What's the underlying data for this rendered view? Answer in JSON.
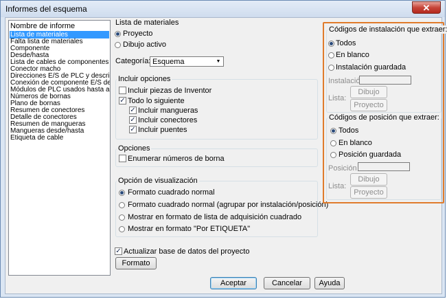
{
  "window": {
    "title": "Informes del esquema",
    "close_label": "✕"
  },
  "report_list": {
    "header": "Nombre de informe",
    "items": [
      "Lista de materiales",
      "Falta lista de materiales",
      "Componente",
      "Desde/hasta",
      "Lista de cables de componentes",
      "Conector macho",
      "Direcciones E/S de PLC y descripciones",
      "Conexión de componente E/S de PLC",
      "Módulos de PLC usados hasta ahora",
      "Números de bornas",
      "Plano de bornas",
      "Resumen de conectores",
      "Detalle de conectores",
      "Resumen de mangueras",
      "Mangueras desde/hasta",
      "Etiqueta de cable"
    ],
    "selected_index": 0
  },
  "bom": {
    "title": "Lista de materiales",
    "project": "Proyecto",
    "active_drawing": "Dibujo activo",
    "category_label": "Categoría:",
    "category_value": "Esquema"
  },
  "include": {
    "title": "Incluir opciones",
    "inventor": "Incluir piezas de Inventor",
    "all": "Todo lo siguiente",
    "hoses": "Incluir mangueras",
    "connectors": "Incluir conectores",
    "bridges": "Incluir puentes"
  },
  "options": {
    "title": "Opciones",
    "enumerate": "Enumerar números de borna"
  },
  "display": {
    "title": "Opción de visualización",
    "opt1": "Formato cuadrado normal",
    "opt2": "Formato cuadrado normal (agrupar por instalación/posición)",
    "opt3": "Mostrar en formato de lista de adquisición cuadrado",
    "opt4": "Mostrar en formato \"Por ETIQUETA\""
  },
  "update_db": "Actualizar base de datos del proyecto",
  "format_button": "Formato",
  "install_codes": {
    "title": "Códigos de instalación que extraer:",
    "all": "Todos",
    "blank": "En blanco",
    "saved": "Instalación guardada",
    "field_label": "Instalación",
    "list_label": "Lista:",
    "drawing": "Dibujo",
    "project": "Proyecto"
  },
  "position_codes": {
    "title": "Códigos de posición que extraer:",
    "all": "Todos",
    "blank": "En blanco",
    "saved": "Posición guardada",
    "field_label": "Posición",
    "list_label": "Lista:",
    "drawing": "Dibujo",
    "project": "Proyecto"
  },
  "buttons": {
    "ok": "Aceptar",
    "cancel": "Cancelar",
    "help": "Ayuda"
  },
  "colors": {
    "highlight": "#e07b2b",
    "selection": "#3399ff"
  }
}
